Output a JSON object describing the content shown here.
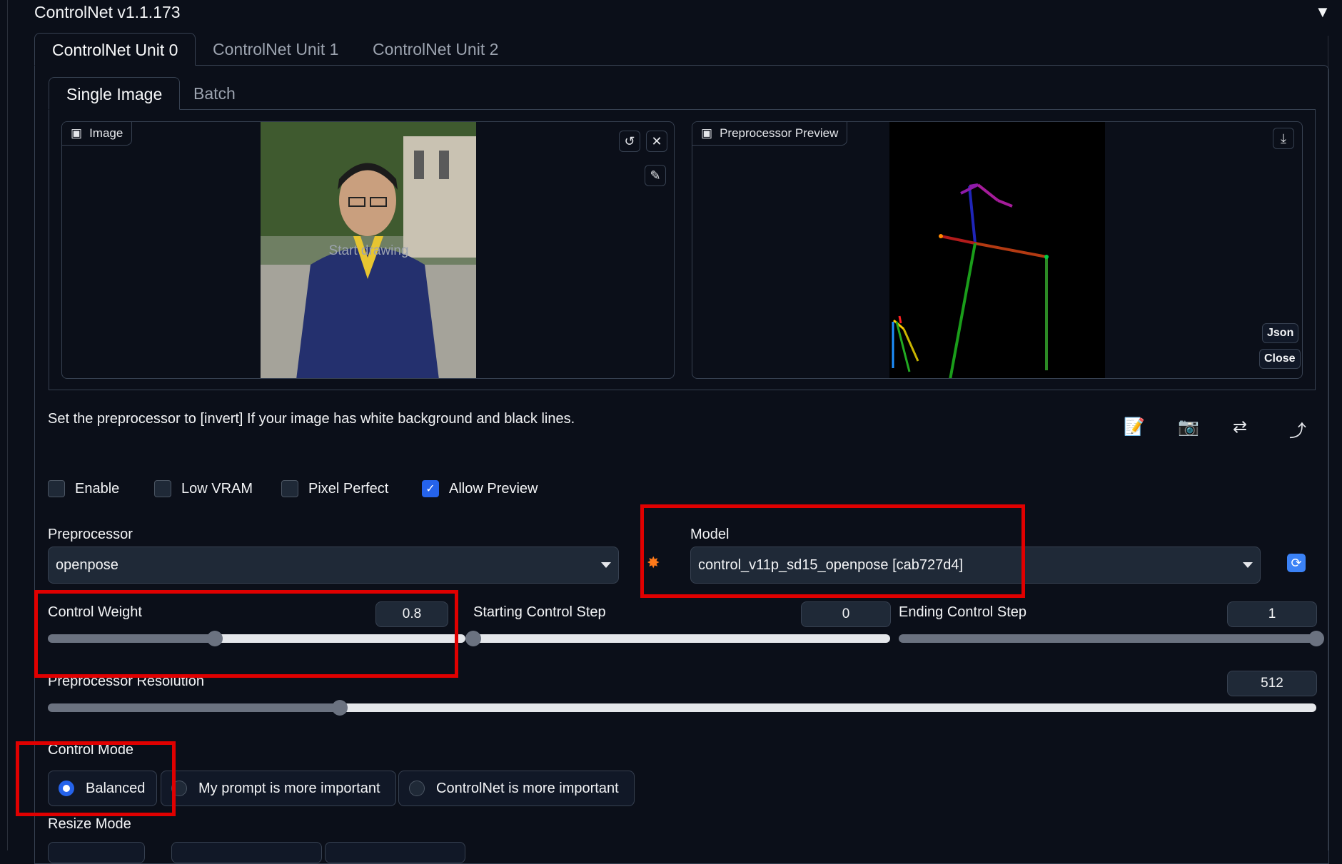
{
  "section": {
    "title": "ControlNet v1.1.173"
  },
  "unit_tabs": [
    "ControlNet Unit 0",
    "ControlNet Unit 1",
    "ControlNet Unit 2"
  ],
  "mode_tabs": [
    "Single Image",
    "Batch"
  ],
  "image_panel": {
    "label": "Image",
    "overlay": "Start drawing"
  },
  "preview_panel": {
    "label": "Preprocessor Preview",
    "json_btn": "Json",
    "close_btn": "Close"
  },
  "hint": "Set the preprocessor to [invert] If your image has white background and black lines.",
  "checkboxes": [
    {
      "label": "Enable",
      "checked": false
    },
    {
      "label": "Low VRAM",
      "checked": false
    },
    {
      "label": "Pixel Perfect",
      "checked": false
    },
    {
      "label": "Allow Preview",
      "checked": true
    }
  ],
  "preprocessor": {
    "label": "Preprocessor",
    "value": "openpose"
  },
  "model": {
    "label": "Model",
    "value": "control_v11p_sd15_openpose [cab727d4]"
  },
  "sliders": {
    "control_weight": {
      "label": "Control Weight",
      "value": "0.8",
      "fraction": 0.4
    },
    "starting_step": {
      "label": "Starting Control Step",
      "value": "0",
      "fraction": 0.0
    },
    "ending_step": {
      "label": "Ending Control Step",
      "value": "1",
      "fraction": 1.0
    },
    "preprocessor_resolution": {
      "label": "Preprocessor Resolution",
      "value": "512",
      "fraction": 0.23
    }
  },
  "control_mode": {
    "label": "Control Mode",
    "options": [
      "Balanced",
      "My prompt is more important",
      "ControlNet is more important"
    ],
    "selected": "Balanced"
  },
  "resize_mode": {
    "label": "Resize Mode"
  },
  "colors": {
    "accent": "#2563eb",
    "highlight": "#e00000",
    "background": "#0b0f19"
  }
}
